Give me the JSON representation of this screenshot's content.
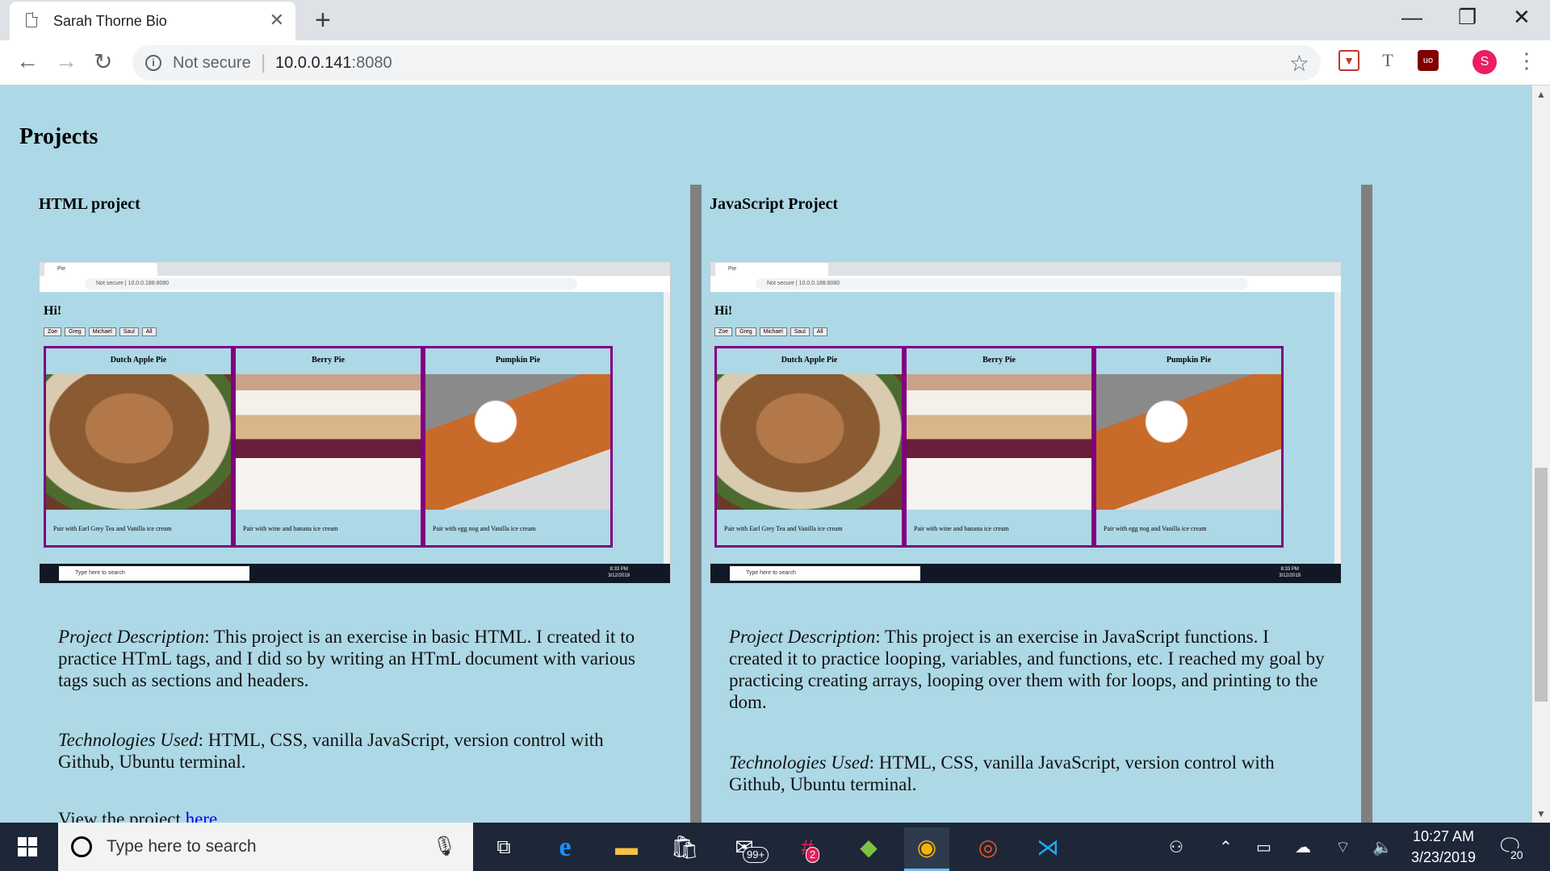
{
  "browser": {
    "tab_title": "Sarah Thorne Bio",
    "tab_close": "✕",
    "new_tab": "+",
    "not_secure": "Not secure",
    "url_host": "10.0.0.141",
    "url_port": ":8080",
    "avatar_letter": "S",
    "window_controls": [
      "—",
      "❐",
      "✕"
    ]
  },
  "page": {
    "section_title": "Projects",
    "projects": [
      {
        "title": "HTML project",
        "desc_label": "Project Description",
        "desc_text": ": This project is an exercise in basic HTML. I created it to practice HTmL tags, and I did so by writing an HTmL document with various tags such as sections and headers.",
        "tech_label": "Technologies Used",
        "tech_text": ": HTML, CSS, vanilla JavaScript, version control with Github, Ubuntu terminal.",
        "view_text": "View the project ",
        "view_link": "here"
      },
      {
        "title": "JavaScript Project",
        "desc_label": "Project Description",
        "desc_text": ": This project is an exercise in JavaScript functions. I created it to practice looping, variables, and functions, etc. I reached my goal by practicing creating arrays, looping over them with for loops, and printing to the dom.",
        "tech_label": "Technologies Used",
        "tech_text": ": HTML, CSS, vanilla JavaScript, version control with Github, Ubuntu terminal."
      }
    ],
    "screenshot": {
      "tab": "Pie",
      "omnibox": "Not secure | 10.0.0.188:8080",
      "greeting": "Hi!",
      "buttons": [
        "Zoe",
        "Greg",
        "Michael",
        "Saul",
        "All"
      ],
      "cards": [
        {
          "title": "Dutch Apple Pie",
          "pair": "Pair with Earl Grey Tea and Vanilla ice cream"
        },
        {
          "title": "Berry Pie",
          "pair": "Pair with wine and banana ice cream"
        },
        {
          "title": "Pumpkin Pie",
          "pair": "Pair with egg nog and Vanilla ice cream"
        }
      ],
      "taskbar_search": "Type here to search",
      "time": "8:33 PM",
      "date": "3/12/2019"
    }
  },
  "taskbar": {
    "search_placeholder": "Type here to search",
    "time": "10:27 AM",
    "date": "3/23/2019",
    "mail_badge": "99+",
    "slack_badge": "2",
    "notification_count": "20"
  }
}
